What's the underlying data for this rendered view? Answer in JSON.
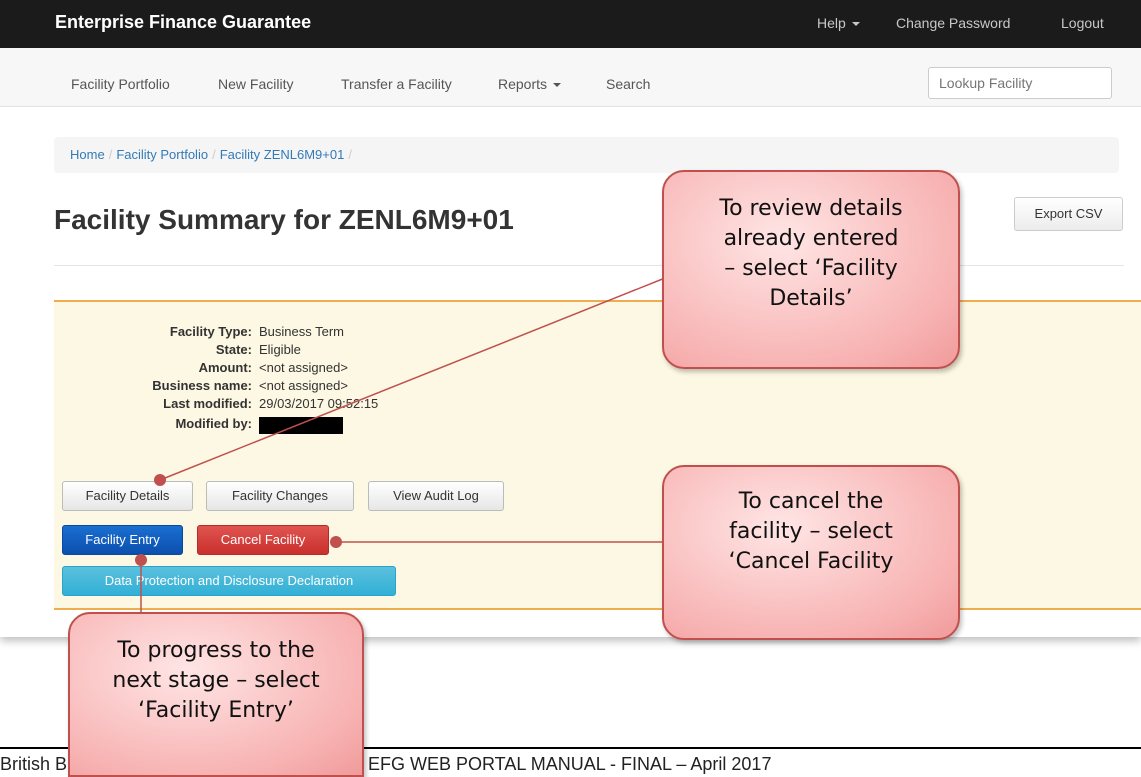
{
  "app": {
    "brand": "Enterprise Finance Guarantee",
    "top_nav": {
      "help": "Help",
      "change_password": "Change Password",
      "logout": "Logout"
    }
  },
  "nav": {
    "items": [
      "Facility Portfolio",
      "New Facility",
      "Transfer a Facility",
      "Reports",
      "Search"
    ],
    "lookup_placeholder": "Lookup Facility"
  },
  "breadcrumb": {
    "home": "Home",
    "portfolio": "Facility Portfolio",
    "facility": "Facility ZENL6M9+01",
    "sep": "/"
  },
  "page": {
    "title": "Facility Summary for ZENL6M9+01",
    "export_label": "Export CSV"
  },
  "details": [
    {
      "label": "Facility Type:",
      "value": "Business Term"
    },
    {
      "label": "State:",
      "value": "Eligible"
    },
    {
      "label": "Amount:",
      "value": "<not assigned>"
    },
    {
      "label": "Business name:",
      "value": "<not assigned>"
    },
    {
      "label": "Last modified:",
      "value": "29/03/2017 09:52:15"
    },
    {
      "label": "Modified by:",
      "value": ""
    }
  ],
  "buttons": {
    "facility_details": "Facility Details",
    "facility_changes": "Facility Changes",
    "view_audit_log": "View Audit Log",
    "facility_entry": "Facility Entry",
    "cancel_facility": "Cancel Facility",
    "data_protection": "Data Protection and Disclosure Declaration"
  },
  "callouts": {
    "review": [
      "To review details",
      "already entered",
      "– select ‘Facility",
      "Details’"
    ],
    "cancel": [
      "To cancel the",
      "facility – select",
      "‘Cancel Facility"
    ],
    "progress": [
      "To progress to the",
      "next stage – select",
      "‘Facility Entry’"
    ]
  },
  "footer": {
    "left": "British B",
    "right": "EFG WEB PORTAL MANUAL - FINAL – April 2017"
  },
  "colors": {
    "callout_fill": "#f7b0b0",
    "callout_border": "#c0504d",
    "panel_bg": "#fcf8e3",
    "panel_border": "#f0ad4e"
  }
}
